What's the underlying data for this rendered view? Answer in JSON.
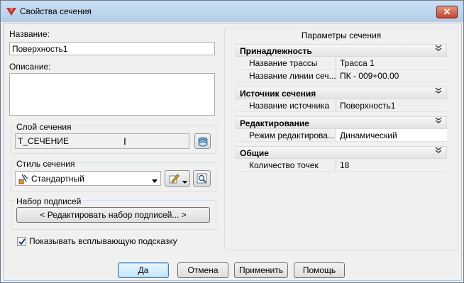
{
  "window": {
    "title": "Свойства сечения",
    "close_symbol": "✕"
  },
  "general": {
    "name_label": "Название:",
    "name_value": "Поверхность1",
    "description_label": "Описание:",
    "description_value": ""
  },
  "layer": {
    "group_label": "Слой сечения",
    "value": "Т_СЕЧЕНИЕ"
  },
  "style": {
    "group_label": "Стиль сечения",
    "selected": "Стандартный"
  },
  "label_set": {
    "group_label": "Набор подписей",
    "edit_button": "< Редактировать набор подписей... >"
  },
  "tooltip_checkbox": {
    "label": "Показывать всплывающую подсказку",
    "checked": true
  },
  "params": {
    "title": "Параметры сечения",
    "sections": [
      {
        "title": "Принадлежность",
        "rows": [
          {
            "key": "Название трассы",
            "value": "Трасса 1",
            "editable": false
          },
          {
            "key": "Название линии сеч...",
            "value": "ПК - 009+00.00",
            "editable": false
          }
        ]
      },
      {
        "title": "Источник сечения",
        "rows": [
          {
            "key": "Название источника",
            "value": "Поверхность1",
            "editable": false
          }
        ]
      },
      {
        "title": "Редактирование",
        "rows": [
          {
            "key": "Режим редактирова...",
            "value": "Динамический",
            "editable": true
          }
        ]
      },
      {
        "title": "Общие",
        "rows": [
          {
            "key": "Количество точек",
            "value": "18",
            "editable": false
          }
        ]
      }
    ]
  },
  "footer": {
    "ok": "Да",
    "cancel": "Отмена",
    "apply": "Применить",
    "help": "Помощь"
  },
  "colors": {
    "titlebar": "#b4cde8",
    "close": "#c4432c",
    "default_button_border": "#3c7fb1"
  },
  "icons": {
    "app": "civil-3d-icon",
    "layer": "layer-stack-icon",
    "style_edit": "edit-style-icon",
    "style_preview": "preview-icon",
    "collapse": "double-chevron-up-icon"
  }
}
